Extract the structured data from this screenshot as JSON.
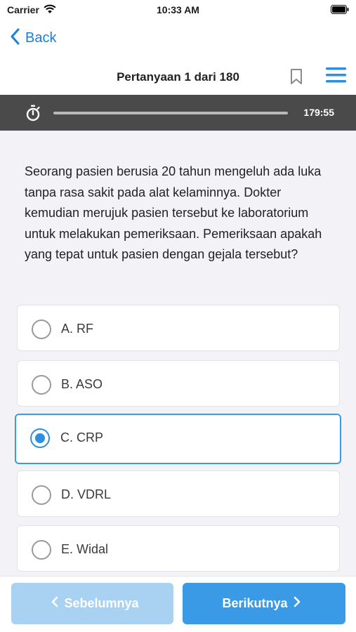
{
  "status_bar": {
    "carrier": "Carrier",
    "time": "10:33 AM"
  },
  "nav": {
    "back_label": "Back",
    "accent_color": "#1a7fd8"
  },
  "header": {
    "title": "Pertanyaan 1 dari 180"
  },
  "timer": {
    "remaining": "179:55",
    "progress_fraction": 1.0
  },
  "question": {
    "text": "Seorang pasien berusia 20 tahun mengeluh ada luka tanpa rasa sakit pada alat kelaminnya. Dokter kemudian merujuk pasien tersebut ke laboratorium untuk melakukan pemeriksaan. Pemeriksaan apakah yang tepat untuk pasien dengan gejala tersebut?"
  },
  "options": [
    {
      "label": "A. RF",
      "selected": false
    },
    {
      "label": "B. ASO",
      "selected": false
    },
    {
      "label": "C. CRP",
      "selected": true
    },
    {
      "label": "D. VDRL",
      "selected": false
    },
    {
      "label": "E. Widal",
      "selected": false
    }
  ],
  "footer": {
    "prev_label": "Sebelumnya",
    "next_label": "Berikutnya",
    "prev_color": "#a9d1f2",
    "next_color": "#3a9ae6"
  }
}
